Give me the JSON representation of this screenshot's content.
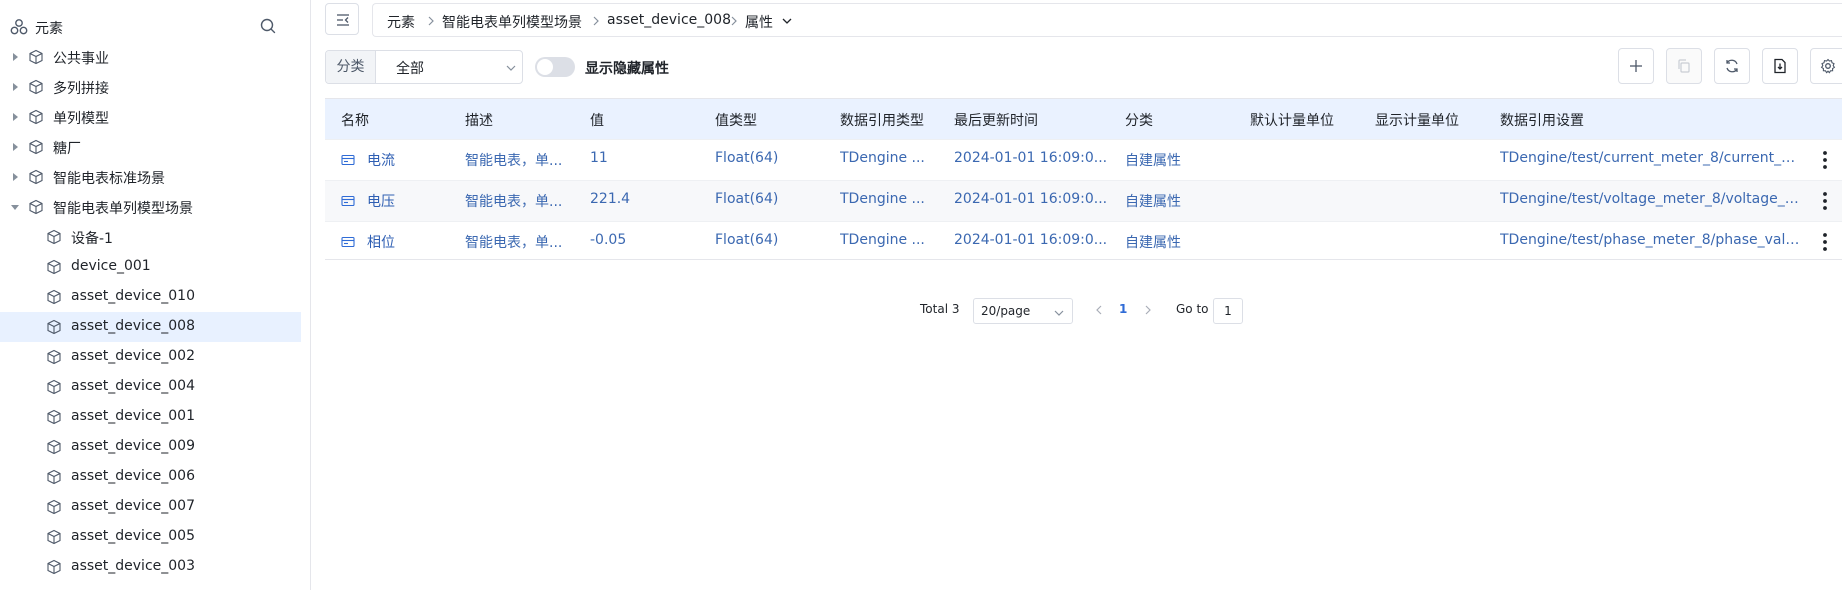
{
  "sidebar": {
    "title": "元素",
    "tree": [
      {
        "label": "公共事业",
        "level": 0,
        "expanded": false
      },
      {
        "label": "多列拼接",
        "level": 0,
        "expanded": false
      },
      {
        "label": "单列模型",
        "level": 0,
        "expanded": false
      },
      {
        "label": "糖厂",
        "level": 0,
        "expanded": false
      },
      {
        "label": "智能电表标准场景",
        "level": 0,
        "expanded": false
      },
      {
        "label": "智能电表单列模型场景",
        "level": 0,
        "expanded": true
      },
      {
        "label": "设备-1",
        "level": 1
      },
      {
        "label": "device_001",
        "level": 1
      },
      {
        "label": "asset_device_010",
        "level": 1
      },
      {
        "label": "asset_device_008",
        "level": 1,
        "selected": true
      },
      {
        "label": "asset_device_002",
        "level": 1
      },
      {
        "label": "asset_device_004",
        "level": 1
      },
      {
        "label": "asset_device_001",
        "level": 1
      },
      {
        "label": "asset_device_009",
        "level": 1
      },
      {
        "label": "asset_device_006",
        "level": 1
      },
      {
        "label": "asset_device_007",
        "level": 1
      },
      {
        "label": "asset_device_005",
        "level": 1
      },
      {
        "label": "asset_device_003",
        "level": 1
      }
    ]
  },
  "breadcrumb": [
    "元素",
    "智能电表单列模型场景",
    "asset_device_008",
    "属性"
  ],
  "toolbar": {
    "filter_label": "分类",
    "filter_value": "全部",
    "toggle_label": "显示隐藏属性",
    "toggle_on": false
  },
  "table": {
    "columns": [
      "名称",
      "描述",
      "值",
      "值类型",
      "数据引用类型",
      "最后更新时间",
      "分类",
      "默认计量单位",
      "显示计量单位",
      "数据引用设置"
    ],
    "rows": [
      {
        "name": "电流",
        "desc": "智能电表，单...",
        "value": "11",
        "type": "Float(64)",
        "ref_type": "TDengine ...",
        "updated": "2024-01-01 16:09:0...",
        "category": "自建属性",
        "default_unit": "",
        "display_unit": "",
        "ref_setting": "TDengine/test/current_meter_8/current_va..."
      },
      {
        "name": "电压",
        "desc": "智能电表，单...",
        "value": "221.4",
        "type": "Float(64)",
        "ref_type": "TDengine ...",
        "updated": "2024-01-01 16:09:0...",
        "category": "自建属性",
        "default_unit": "",
        "display_unit": "",
        "ref_setting": "TDengine/test/voltage_meter_8/voltage_val..."
      },
      {
        "name": "相位",
        "desc": "智能电表，单...",
        "value": "-0.05",
        "type": "Float(64)",
        "ref_type": "TDengine ...",
        "updated": "2024-01-01 16:09:0...",
        "category": "自建属性",
        "default_unit": "",
        "display_unit": "",
        "ref_setting": "TDengine/test/phase_meter_8/phase_value"
      }
    ]
  },
  "pagination": {
    "total": "Total 3",
    "page_size": "20/page",
    "current": "1",
    "goto_label": "Go to",
    "goto_value": "1"
  },
  "colors": {
    "accent": "#2f6bd6",
    "selected_bg": "#e8f1ff",
    "header_bg": "#eaf2ff",
    "link": "#2f5fb3"
  }
}
